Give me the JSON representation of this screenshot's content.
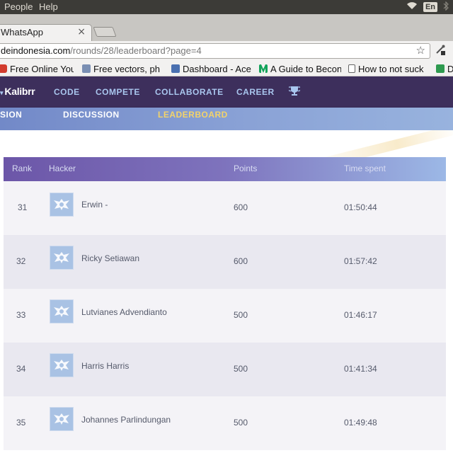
{
  "os_bar": {
    "menus": [
      "People",
      "Help"
    ],
    "language": "En"
  },
  "browser": {
    "tab_title": "WhatsApp",
    "tab_close": "×",
    "url_host": "deindonesia.com",
    "url_path": "/rounds/28/leaderboard?page=4",
    "bookmarks": [
      {
        "label": "Free Online You",
        "icon_color": "#d23c2e",
        "icon": "video-icon"
      },
      {
        "label": "Free vectors, ph",
        "icon_color": "#7a8fb3",
        "icon": "image-icon"
      },
      {
        "label": "Dashboard - Ace",
        "icon_color": "#4a70b0",
        "icon": "dashboard-icon"
      },
      {
        "label": "A Guide to Becon",
        "icon_color": "#12a35a",
        "icon": "medium-icon"
      },
      {
        "label": "How to not suck",
        "icon_color": "#ffffff",
        "icon": "page-icon"
      },
      {
        "label": "D",
        "icon_color": "#2e9a4f",
        "icon": "sheet-icon"
      }
    ]
  },
  "site": {
    "logo": "Kalibrr",
    "nav": [
      "CODE",
      "COMPETE",
      "COLLABORATE",
      "CAREER"
    ],
    "subnav": [
      "SION",
      "DISCUSSION",
      "LEADERBOARD"
    ],
    "colors": {
      "nav_bg": "#3d2f5c",
      "nav_text": "#a9c6ee",
      "active_tab": "#f3d36a"
    }
  },
  "leaderboard": {
    "headers": {
      "rank": "Rank",
      "hacker": "Hacker",
      "points": "Points",
      "time": "Time spent"
    },
    "rows": [
      {
        "rank": "31",
        "name": "Erwin -",
        "points": "600",
        "time": "01:50:44"
      },
      {
        "rank": "32",
        "name": "Ricky Setiawan",
        "points": "600",
        "time": "01:57:42"
      },
      {
        "rank": "33",
        "name": "Lutvianes Advendianto",
        "points": "500",
        "time": "01:46:17"
      },
      {
        "rank": "34",
        "name": "Harris Harris",
        "points": "500",
        "time": "01:41:34"
      },
      {
        "rank": "35",
        "name": "Johannes Parlindungan",
        "points": "500",
        "time": "01:49:48"
      }
    ]
  }
}
